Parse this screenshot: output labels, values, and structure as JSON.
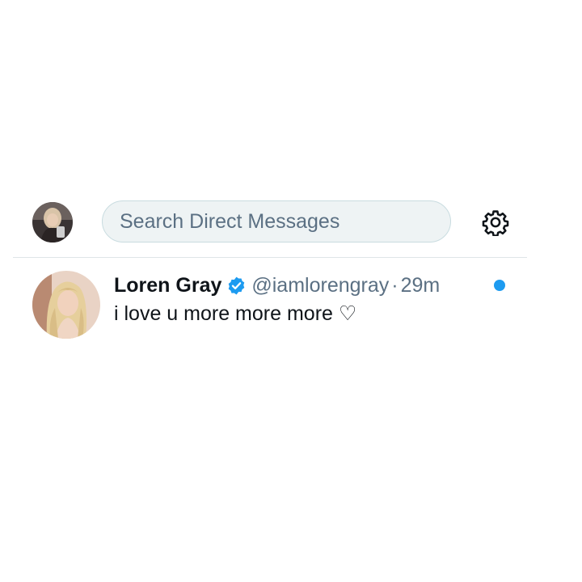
{
  "header": {
    "search": {
      "placeholder": "Search Direct Messages",
      "value": ""
    },
    "settings_icon": "gear-icon"
  },
  "conversations": [
    {
      "display_name": "Loren Gray",
      "verified": true,
      "verified_icon": "verified-badge-icon",
      "handle": "@iamlorengray",
      "separator": "·",
      "timestamp": "29m",
      "preview": "i love u more more more ♡",
      "unread": true
    }
  ],
  "colors": {
    "accent": "#1d9bf0",
    "text_primary": "#0f1419",
    "text_secondary": "#5b7083",
    "search_bg": "#eef3f4",
    "divider": "#dfe5e8"
  }
}
